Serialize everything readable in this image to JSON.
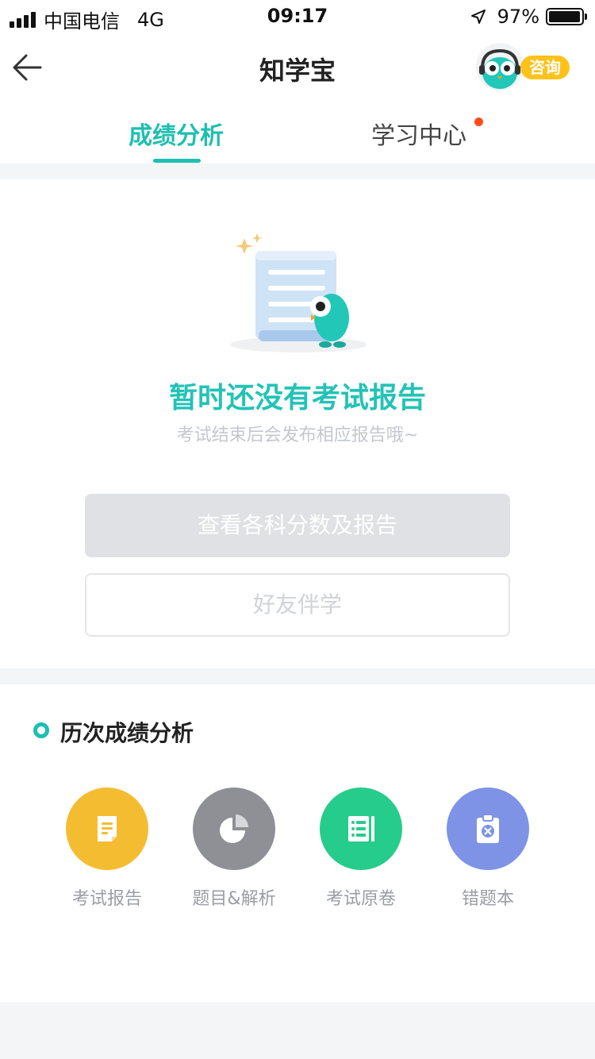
{
  "status_bar": {
    "carrier": "中国电信",
    "network": "4G",
    "time": "09:17",
    "battery": "97%",
    "battery_level": 0.97
  },
  "nav": {
    "title": "知学宝",
    "consult_label": "咨询",
    "back_icon": "arrow-left-icon",
    "mascot_icon": "owl-headset-icon"
  },
  "tabs": [
    {
      "label": "成绩分析",
      "active": true
    },
    {
      "label": "学习中心",
      "active": false,
      "has_dot": true
    }
  ],
  "empty_state": {
    "icon": "empty-report-owl-icon",
    "title": "暂时还没有考试报告",
    "subtitle": "考试结束后会发布相应报告哦~"
  },
  "buttons": {
    "view_scores": "查看各科分数及报告",
    "study_with_friends": "好友伴学"
  },
  "history": {
    "title": "历次成绩分析",
    "entries": [
      {
        "label": "考试报告",
        "icon": "document-icon",
        "color": "#f4bd31"
      },
      {
        "label": "题目&解析",
        "icon": "pie-chart-icon",
        "color": "#8e9096"
      },
      {
        "label": "考试原卷",
        "icon": "list-icon",
        "color": "#26cc8b"
      },
      {
        "label": "错题本",
        "icon": "clipboard-x-icon",
        "color": "#7e93e6"
      }
    ]
  },
  "colors": {
    "accent": "#1ebfb0",
    "notification_dot": "#ff4d1a",
    "consult_badge": "#ffc21a"
  }
}
